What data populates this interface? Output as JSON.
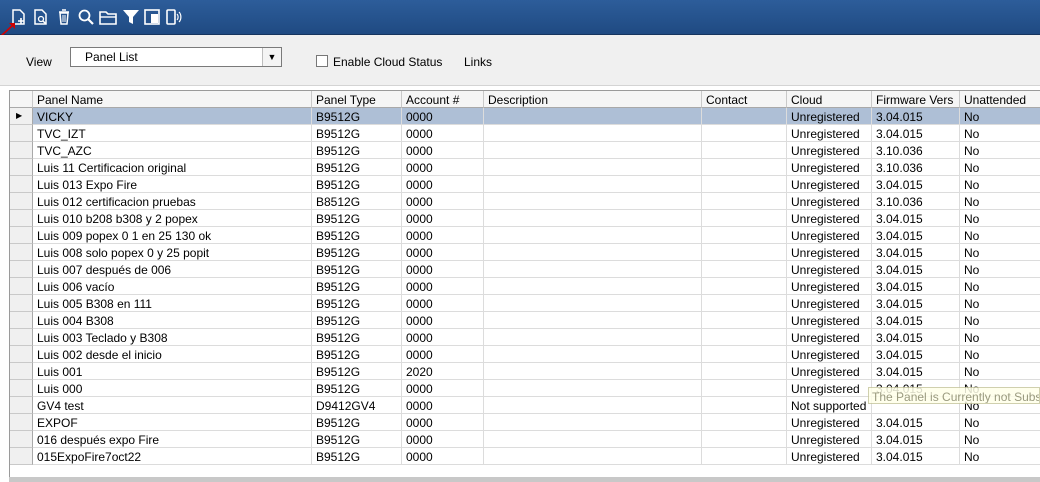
{
  "toolbar": {
    "icons": [
      "new-panel-icon",
      "preview-icon",
      "delete-icon",
      "search-icon",
      "open-folder-icon",
      "filter-icon",
      "window-icon",
      "connect-icon"
    ],
    "background": "#2d5d9a"
  },
  "view": {
    "label": "View",
    "selected": "Panel List",
    "checkbox_label": "Enable Cloud Status",
    "checkbox_checked": false,
    "links_label": "Links"
  },
  "grid": {
    "columns": [
      "Panel Name",
      "Panel Type",
      "Account #",
      "Description",
      "Contact",
      "Cloud",
      "Firmware Vers",
      "Unattended"
    ],
    "selected_row": 0,
    "rows": [
      [
        "VICKY",
        "B9512G",
        "0000",
        "",
        "",
        "Unregistered",
        "3.04.015",
        "No"
      ],
      [
        "TVC_IZT",
        "B9512G",
        "0000",
        "",
        "",
        "Unregistered",
        "3.04.015",
        "No"
      ],
      [
        "TVC_AZC",
        "B9512G",
        "0000",
        "",
        "",
        "Unregistered",
        "3.10.036",
        "No"
      ],
      [
        "Luis 11 Certificacion original",
        "B9512G",
        "0000",
        "",
        "",
        "Unregistered",
        "3.10.036",
        "No"
      ],
      [
        "Luis 013 Expo Fire",
        "B9512G",
        "0000",
        "",
        "",
        "Unregistered",
        "3.04.015",
        "No"
      ],
      [
        "Luis 012 certificacion pruebas",
        "B8512G",
        "0000",
        "",
        "",
        "Unregistered",
        "3.10.036",
        "No"
      ],
      [
        "Luis 010 b208 b308 y 2 popex",
        "B9512G",
        "0000",
        "",
        "",
        "Unregistered",
        "3.04.015",
        "No"
      ],
      [
        "Luis 009 popex 0 1 en 25 130 ok",
        "B9512G",
        "0000",
        "",
        "",
        "Unregistered",
        "3.04.015",
        "No"
      ],
      [
        "Luis 008 solo popex 0 y 25 popit",
        "B9512G",
        "0000",
        "",
        "",
        "Unregistered",
        "3.04.015",
        "No"
      ],
      [
        "Luis 007 después de 006",
        "B9512G",
        "0000",
        "",
        "",
        "Unregistered",
        "3.04.015",
        "No"
      ],
      [
        "Luis 006 vacío",
        "B9512G",
        "0000",
        "",
        "",
        "Unregistered",
        "3.04.015",
        "No"
      ],
      [
        "Luis 005 B308 en 111",
        "B9512G",
        "0000",
        "",
        "",
        "Unregistered",
        "3.04.015",
        "No"
      ],
      [
        "Luis 004 B308",
        "B9512G",
        "0000",
        "",
        "",
        "Unregistered",
        "3.04.015",
        "No"
      ],
      [
        "Luis 003 Teclado y B308",
        "B9512G",
        "0000",
        "",
        "",
        "Unregistered",
        "3.04.015",
        "No"
      ],
      [
        "Luis 002 desde el inicio",
        "B9512G",
        "0000",
        "",
        "",
        "Unregistered",
        "3.04.015",
        "No"
      ],
      [
        "Luis 001",
        "B9512G",
        "2020",
        "",
        "",
        "Unregistered",
        "3.04.015",
        "No"
      ],
      [
        "Luis 000",
        "B9512G",
        "0000",
        "",
        "",
        "Unregistered",
        "3.04.015",
        "No"
      ],
      [
        "GV4 test",
        "D9412GV4",
        "0000",
        "",
        "",
        "Not supported",
        "",
        "No"
      ],
      [
        "EXPOF",
        "B9512G",
        "0000",
        "",
        "",
        "Unregistered",
        "3.04.015",
        "No"
      ],
      [
        "016 después expo Fire",
        "B9512G",
        "0000",
        "",
        "",
        "Unregistered",
        "3.04.015",
        "No"
      ],
      [
        "015ExpoFire7oct22",
        "B9512G",
        "0000",
        "",
        "",
        "Unregistered",
        "3.04.015",
        "No"
      ]
    ]
  },
  "tooltip": "The Panel is Currently not Subsc"
}
